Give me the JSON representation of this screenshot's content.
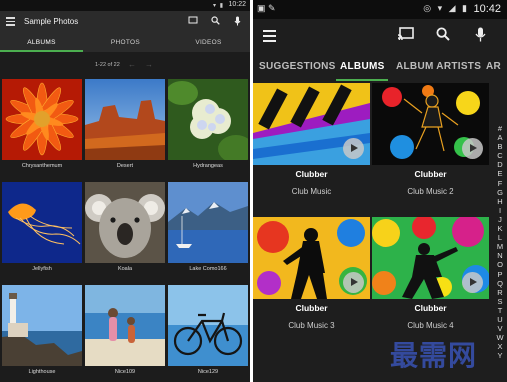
{
  "left_phone": {
    "status": {
      "time": "10:22",
      "icons_text": "▾ ▮"
    },
    "appbar": {
      "title": "Sample Photos",
      "icons": [
        "cast-icon",
        "search-icon",
        "mic-icon"
      ]
    },
    "tabs": [
      {
        "label": "ALBUMS",
        "active": true
      },
      {
        "label": "PHOTOS",
        "active": false
      },
      {
        "label": "VIDEOS",
        "active": false
      }
    ],
    "pager": {
      "range": "1-22 of 22",
      "prev": "←",
      "next": "→"
    },
    "photos": [
      {
        "caption": "Chrysanthemum"
      },
      {
        "caption": "Desert"
      },
      {
        "caption": "Hydrangeas"
      },
      {
        "caption": "Jellyfish"
      },
      {
        "caption": "Koala"
      },
      {
        "caption": "Lake Como166"
      },
      {
        "caption": "Lighthouse"
      },
      {
        "caption": "Nice109"
      },
      {
        "caption": "Nice129"
      }
    ]
  },
  "right_phone": {
    "status": {
      "time": "10:42",
      "left_icons": "▣ ✎",
      "right_icons": "◎ ▾ ◢ ▮"
    },
    "appbar": {
      "icons": [
        "cast-icon",
        "search-icon",
        "mic-icon"
      ]
    },
    "tabs": [
      {
        "label": "SUGGESTIONS",
        "active": false
      },
      {
        "label": "ALBUMS",
        "active": true
      },
      {
        "label": "ALBUM ARTISTS",
        "active": false
      },
      {
        "label": "AR",
        "active": false
      }
    ],
    "albums": [
      {
        "artist": "Clubber",
        "title": "Club Music"
      },
      {
        "artist": "Clubber",
        "title": "Club Music 2"
      },
      {
        "artist": "Clubber",
        "title": "Club Music 3"
      },
      {
        "artist": "Clubber",
        "title": "Club Music 4"
      }
    ],
    "alphabet": [
      "#",
      "A",
      "B",
      "C",
      "D",
      "E",
      "F",
      "G",
      "H",
      "I",
      "J",
      "K",
      "L",
      "M",
      "N",
      "O",
      "P",
      "Q",
      "R",
      "S",
      "T",
      "U",
      "V",
      "W",
      "X",
      "Y"
    ]
  },
  "watermark": "最需网",
  "colors": {
    "accent": "#4caf50",
    "bg_dark": "#1e1e1e",
    "bar": "#2b2b2b"
  }
}
